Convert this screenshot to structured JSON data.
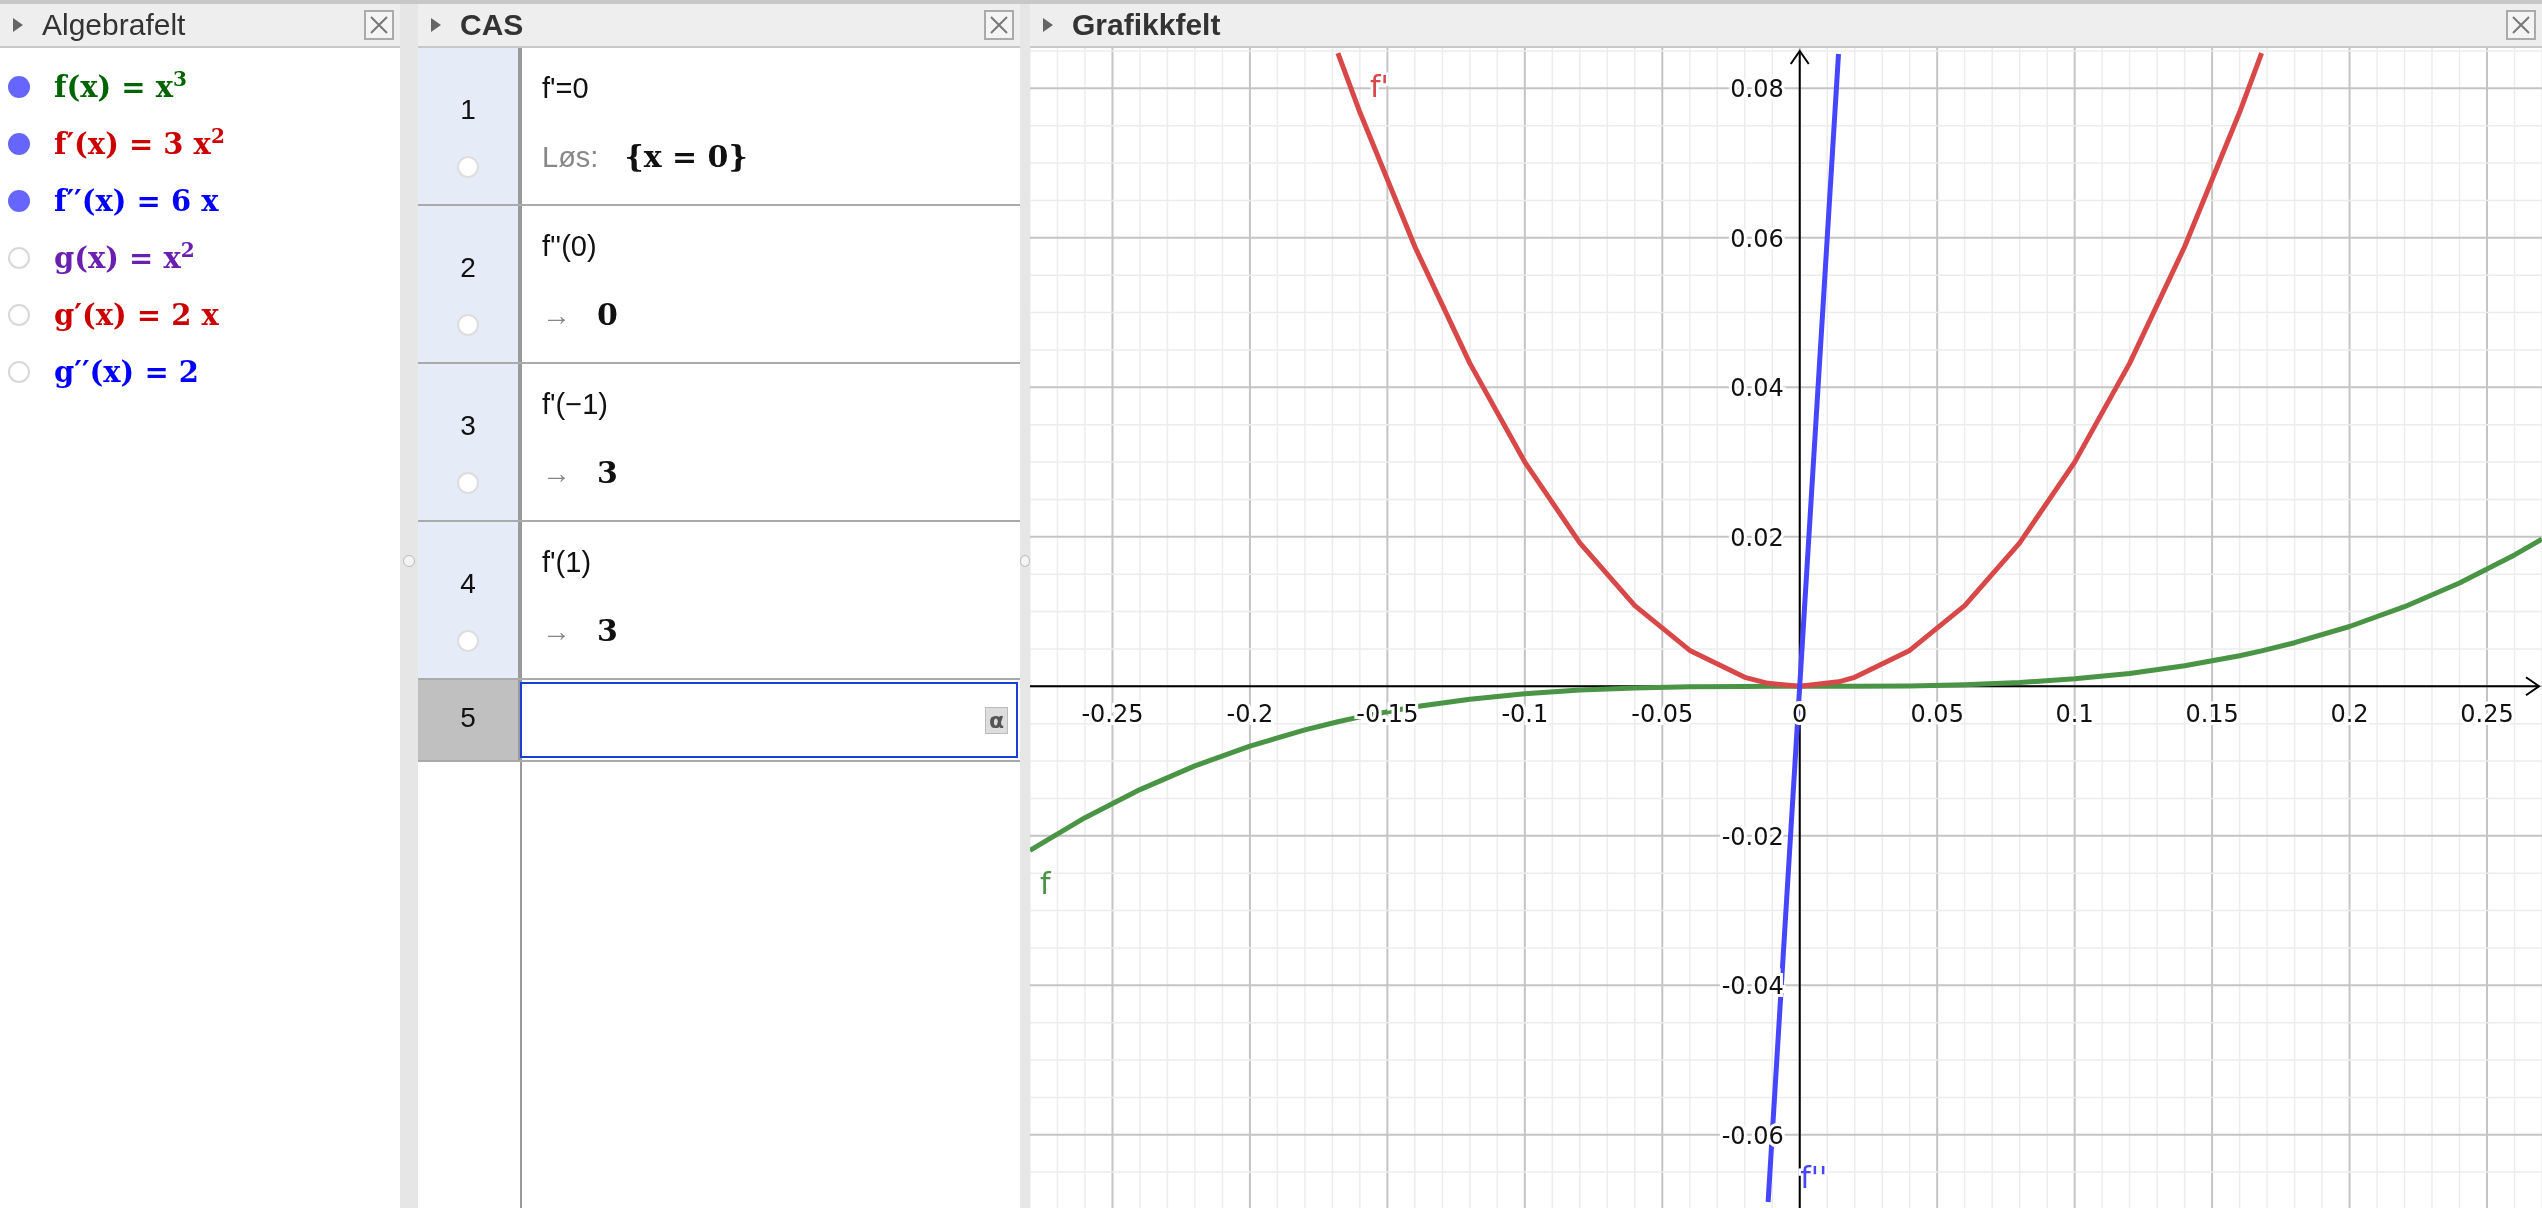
{
  "algebra": {
    "title": "Algebrafelt",
    "title_bold": false,
    "items": [
      {
        "formula": "f(x) = x$^{3}$",
        "color": "#006400",
        "shown": true
      },
      {
        "formula": "f′(x) = 3 x$^{2}$",
        "color": "#cc0000",
        "shown": true
      },
      {
        "formula": "f′′(x) = 6 x",
        "color": "#0000ff",
        "shown": true
      },
      {
        "formula": "g(x) = x$^{2}$",
        "color": "#6a1fb0",
        "shown": false
      },
      {
        "formula": "g′(x) = 2 x",
        "color": "#cc0000",
        "shown": false
      },
      {
        "formula": "g′′(x) = 2",
        "color": "#0000ff",
        "shown": false
      }
    ]
  },
  "cas": {
    "title": "CAS",
    "title_bold": true,
    "rows": [
      {
        "number": "1",
        "input": "f'=0",
        "output_prefix": "Løs:",
        "output": "{x = 0}",
        "checked": false,
        "selected": false
      },
      {
        "number": "2",
        "input": "f''(0)",
        "output_prefix": "→",
        "output": "0",
        "checked": false,
        "selected": false
      },
      {
        "number": "3",
        "input": "f'(−1)",
        "output_prefix": "→",
        "output": "3",
        "checked": false,
        "selected": false
      },
      {
        "number": "4",
        "input": "f'(1)",
        "output_prefix": "→",
        "output": "3",
        "checked": false,
        "selected": false
      },
      {
        "number": "5",
        "input_button": "α",
        "selected": true
      }
    ]
  },
  "graph": {
    "title": "Grafikkfelt",
    "title_bold": true,
    "chart_data": {
      "type": "line",
      "grid": true,
      "xlim": [
        -0.28,
        0.27
      ],
      "ylim": [
        -0.0698,
        0.0854
      ],
      "xticks": [
        -0.25,
        -0.2,
        -0.15,
        -0.1,
        -0.05,
        0,
        0.05,
        0.1,
        0.15,
        0.2,
        0.25
      ],
      "yticks": [
        -0.06,
        -0.04,
        -0.02,
        0.02,
        0.04,
        0.06,
        0.08
      ],
      "x": [
        -0.28,
        -0.26,
        -0.24,
        -0.22,
        -0.2,
        -0.18,
        -0.168,
        -0.16,
        -0.14,
        -0.12,
        -0.1,
        -0.08,
        -0.06,
        -0.04,
        -0.02,
        -0.0115,
        0,
        0.0141,
        0.02,
        0.04,
        0.06,
        0.08,
        0.1,
        0.12,
        0.14,
        0.16,
        0.168,
        0.18,
        0.2,
        0.22,
        0.24,
        0.26,
        0.27
      ],
      "series": [
        {
          "name": "f",
          "color": "#4a9446",
          "values": [
            -0.02195,
            -0.01758,
            -0.01382,
            -0.01065,
            -0.008,
            -0.00583,
            -0.00474,
            -0.0041,
            -0.00274,
            -0.00173,
            -0.001,
            -0.00051,
            -0.00022,
            -6e-05,
            -1e-05,
            0,
            0,
            0,
            1e-05,
            6e-05,
            0.00022,
            0.00051,
            0.001,
            0.00173,
            0.00274,
            0.0041,
            0.00474,
            0.00583,
            0.008,
            0.01065,
            0.01382,
            0.01758,
            0.01968
          ]
        },
        {
          "name": "f'",
          "color": "#d94848",
          "values": [
            null,
            null,
            null,
            null,
            null,
            null,
            0.0847,
            0.0768,
            0.0588,
            0.0432,
            0.03,
            0.0192,
            0.0108,
            0.0048,
            0.0012,
            0.0004,
            0,
            0.0006,
            0.0012,
            0.0048,
            0.0108,
            0.0192,
            0.03,
            0.0432,
            0.0588,
            0.0768,
            0.0847,
            null,
            null,
            null,
            null,
            null,
            null
          ]
        },
        {
          "name": "f''",
          "color": "#4646ff",
          "values": [
            null,
            null,
            null,
            null,
            null,
            null,
            null,
            null,
            null,
            null,
            null,
            null,
            null,
            null,
            null,
            -0.069,
            0,
            0.0846,
            null,
            null,
            null,
            null,
            null,
            null,
            null,
            null,
            null,
            null,
            null,
            null,
            null,
            null,
            null
          ]
        }
      ]
    }
  }
}
